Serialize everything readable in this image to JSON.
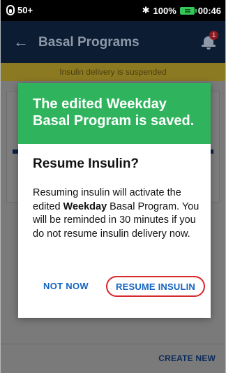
{
  "status_bar": {
    "pod_level": "50+",
    "battery_percent": "100%",
    "time": "00:46",
    "icons": [
      "pod-icon",
      "bluetooth-icon",
      "battery-icon"
    ]
  },
  "header": {
    "title": "Basal Programs",
    "notification_count": "1",
    "icons": [
      "back-arrow-icon",
      "bell-icon"
    ]
  },
  "banner": {
    "text": "Insulin delivery is suspended"
  },
  "background": {
    "create_new_label": "CREATE NEW"
  },
  "dialog": {
    "banner_text": "The edited Weekday Basal Program is saved.",
    "title": "Resume Insulin?",
    "body_before": "Resuming insulin will activate the edited ",
    "body_bold": "Weekday",
    "body_after": " Basal Program. You will be reminded in 30 minutes if you do not resume insulin delivery now.",
    "not_now_label": "NOT NOW",
    "resume_label": "RESUME INSULIN"
  },
  "colors": {
    "success_green": "#2fb35c",
    "link_blue": "#1565c0",
    "highlight_red": "#d7282f",
    "header_navy": "#0b1c33"
  }
}
